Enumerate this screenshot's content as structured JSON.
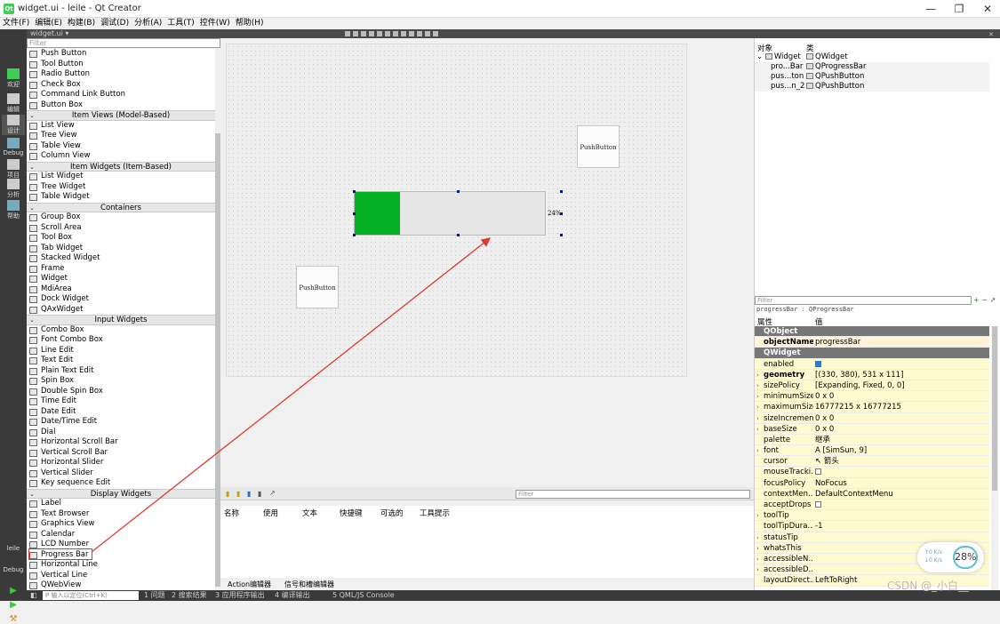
{
  "window": {
    "title": "widget.ui - leile - Qt Creator",
    "controls": [
      "—",
      "❐",
      "✕"
    ]
  },
  "menu": [
    "文件(F)",
    "编辑(E)",
    "构建(B)",
    "调试(D)",
    "分析(A)",
    "工具(T)",
    "控件(W)",
    "帮助(H)"
  ],
  "modes": [
    {
      "label": "欢迎",
      "icon": "qt-logo-icon"
    },
    {
      "label": "编辑",
      "icon": "document-icon"
    },
    {
      "label": "设计",
      "icon": "pencil-icon"
    },
    {
      "label": "Debug",
      "icon": "bug-icon"
    },
    {
      "label": "项目",
      "icon": "wrench-icon"
    },
    {
      "label": "分析",
      "icon": "monitor-icon"
    },
    {
      "label": "帮助",
      "icon": "help-icon"
    }
  ],
  "kit": {
    "project": "leile",
    "config": "Debug"
  },
  "widget_box": {
    "file_combo": "widget.ui",
    "filter_placeholder": "Filter",
    "rows": [
      {
        "type": "item",
        "label": "Push Button",
        "icon": "push-button-icon"
      },
      {
        "type": "item",
        "label": "Tool Button",
        "icon": "tool-button-icon"
      },
      {
        "type": "item",
        "label": "Radio Button",
        "icon": "radio-button-icon"
      },
      {
        "type": "item",
        "label": "Check Box",
        "icon": "check-box-icon"
      },
      {
        "type": "item",
        "label": "Command Link Button",
        "icon": "command-link-icon"
      },
      {
        "type": "item",
        "label": "Button Box",
        "icon": "button-box-icon"
      },
      {
        "type": "cat",
        "label": "Item Views (Model-Based)"
      },
      {
        "type": "item",
        "label": "List View",
        "icon": "list-view-icon"
      },
      {
        "type": "item",
        "label": "Tree View",
        "icon": "tree-view-icon"
      },
      {
        "type": "item",
        "label": "Table View",
        "icon": "table-view-icon"
      },
      {
        "type": "item",
        "label": "Column View",
        "icon": "column-view-icon"
      },
      {
        "type": "cat",
        "label": "Item Widgets (Item-Based)"
      },
      {
        "type": "item",
        "label": "List Widget",
        "icon": "list-widget-icon"
      },
      {
        "type": "item",
        "label": "Tree Widget",
        "icon": "tree-widget-icon"
      },
      {
        "type": "item",
        "label": "Table Widget",
        "icon": "table-widget-icon"
      },
      {
        "type": "cat",
        "label": "Containers"
      },
      {
        "type": "item",
        "label": "Group Box",
        "icon": "group-box-icon"
      },
      {
        "type": "item",
        "label": "Scroll Area",
        "icon": "scroll-area-icon"
      },
      {
        "type": "item",
        "label": "Tool Box",
        "icon": "tool-box-icon"
      },
      {
        "type": "item",
        "label": "Tab Widget",
        "icon": "tab-widget-icon"
      },
      {
        "type": "item",
        "label": "Stacked Widget",
        "icon": "stacked-widget-icon"
      },
      {
        "type": "item",
        "label": "Frame",
        "icon": "frame-icon"
      },
      {
        "type": "item",
        "label": "Widget",
        "icon": "widget-icon"
      },
      {
        "type": "item",
        "label": "MdiArea",
        "icon": "mdi-area-icon"
      },
      {
        "type": "item",
        "label": "Dock Widget",
        "icon": "dock-widget-icon"
      },
      {
        "type": "item",
        "label": "QAxWidget",
        "icon": "ax-widget-icon"
      },
      {
        "type": "cat",
        "label": "Input Widgets"
      },
      {
        "type": "item",
        "label": "Combo Box",
        "icon": "combo-box-icon"
      },
      {
        "type": "item",
        "label": "Font Combo Box",
        "icon": "font-combo-box-icon"
      },
      {
        "type": "item",
        "label": "Line Edit",
        "icon": "line-edit-icon"
      },
      {
        "type": "item",
        "label": "Text Edit",
        "icon": "text-edit-icon"
      },
      {
        "type": "item",
        "label": "Plain Text Edit",
        "icon": "plain-text-edit-icon"
      },
      {
        "type": "item",
        "label": "Spin Box",
        "icon": "spin-box-icon"
      },
      {
        "type": "item",
        "label": "Double Spin Box",
        "icon": "double-spin-box-icon"
      },
      {
        "type": "item",
        "label": "Time Edit",
        "icon": "time-edit-icon"
      },
      {
        "type": "item",
        "label": "Date Edit",
        "icon": "date-edit-icon"
      },
      {
        "type": "item",
        "label": "Date/Time Edit",
        "icon": "date-time-edit-icon"
      },
      {
        "type": "item",
        "label": "Dial",
        "icon": "dial-icon"
      },
      {
        "type": "item",
        "label": "Horizontal Scroll Bar",
        "icon": "hscroll-icon"
      },
      {
        "type": "item",
        "label": "Vertical Scroll Bar",
        "icon": "vscroll-icon"
      },
      {
        "type": "item",
        "label": "Horizontal Slider",
        "icon": "hslider-icon"
      },
      {
        "type": "item",
        "label": "Vertical Slider",
        "icon": "vslider-icon"
      },
      {
        "type": "item",
        "label": "Key sequence Edit",
        "icon": "key-sequence-icon"
      },
      {
        "type": "cat",
        "label": "Display Widgets"
      },
      {
        "type": "item",
        "label": "Label",
        "icon": "label-icon"
      },
      {
        "type": "item",
        "label": "Text Browser",
        "icon": "text-browser-icon"
      },
      {
        "type": "item",
        "label": "Graphics View",
        "icon": "graphics-view-icon"
      },
      {
        "type": "item",
        "label": "Calendar",
        "icon": "calendar-icon"
      },
      {
        "type": "item",
        "label": "LCD Number",
        "icon": "lcd-number-icon"
      },
      {
        "type": "item",
        "label": "Progress Bar",
        "icon": "progress-bar-icon",
        "highlighted": true
      },
      {
        "type": "item",
        "label": "Horizontal Line",
        "icon": "hline-icon"
      },
      {
        "type": "item",
        "label": "Vertical Line",
        "icon": "vline-icon"
      },
      {
        "type": "item",
        "label": "QWebView",
        "icon": "web-view-icon"
      }
    ]
  },
  "form": {
    "push_button_1": "PushButton",
    "push_button_2": "PushButton",
    "progress": {
      "value_fraction": 0.24,
      "text": "24%",
      "chunk_color": "#06b025"
    },
    "arrow_color": "#e0392b"
  },
  "action_editor": {
    "filter_placeholder": "Filter",
    "columns": [
      "名称",
      "使用",
      "文本",
      "快捷键",
      "可选的",
      "工具提示"
    ],
    "tabs": [
      "Action编辑器",
      "信号和槽编辑器"
    ]
  },
  "status_bar": {
    "locator_placeholder": "P 输入以定位(Ctrl+K)",
    "panes": [
      "1 问题",
      "2 搜索结果",
      "3 应用程序输出",
      "4 编译输出",
      "5 QML/JS Console"
    ]
  },
  "object_inspector": {
    "headers": [
      "对象",
      "类"
    ],
    "rows": [
      {
        "object": "Widget",
        "class": "QWidget",
        "level": 0
      },
      {
        "object": "pro...Bar",
        "class": "QProgressBar",
        "level": 1
      },
      {
        "object": "pus...ton",
        "class": "QPushButton",
        "level": 1
      },
      {
        "object": "pus...n_2",
        "class": "QPushButton",
        "level": 1
      }
    ]
  },
  "property_editor": {
    "filter_placeholder": "Filter",
    "title": "progressBar : QProgressBar",
    "headers": [
      "属性",
      "值"
    ],
    "rows": [
      {
        "kind": "sec",
        "name": "QObject"
      },
      {
        "kind": "obj",
        "name": "objectName",
        "value": "progressBar",
        "bold": true
      },
      {
        "kind": "sec",
        "name": "QWidget"
      },
      {
        "kind": "row",
        "name": "enabled",
        "checkbox": true,
        "checked": true
      },
      {
        "kind": "row",
        "name": "geometry",
        "value": "[(330, 380), 531 x 111]",
        "bold": true,
        "expand": true
      },
      {
        "kind": "row",
        "name": "sizePolicy",
        "value": "[Expanding, Fixed, 0, 0]",
        "expand": true
      },
      {
        "kind": "row",
        "name": "minimumSize",
        "value": "0 x 0",
        "expand": true
      },
      {
        "kind": "row",
        "name": "maximumSize",
        "value": "16777215 x 16777215",
        "expand": true
      },
      {
        "kind": "row",
        "name": "sizeIncrement",
        "value": "0 x 0",
        "expand": true
      },
      {
        "kind": "row",
        "name": "baseSize",
        "value": "0 x 0",
        "expand": true
      },
      {
        "kind": "row",
        "name": "palette",
        "value": "继承"
      },
      {
        "kind": "row",
        "name": "font",
        "value": "A  [SimSun, 9]",
        "expand": true
      },
      {
        "kind": "row",
        "name": "cursor",
        "value": "↖ 箭头"
      },
      {
        "kind": "row",
        "name": "mouseTracki...",
        "checkbox": true,
        "checked": false
      },
      {
        "kind": "row",
        "name": "focusPolicy",
        "value": "NoFocus"
      },
      {
        "kind": "row",
        "name": "contextMen...",
        "value": "DefaultContextMenu"
      },
      {
        "kind": "row",
        "name": "acceptDrops",
        "checkbox": true,
        "checked": false
      },
      {
        "kind": "row",
        "name": "toolTip",
        "value": "",
        "expand": true
      },
      {
        "kind": "row",
        "name": "toolTipDura...",
        "value": "-1"
      },
      {
        "kind": "row",
        "name": "statusTip",
        "value": "",
        "expand": true
      },
      {
        "kind": "row",
        "name": "whatsThis",
        "value": "",
        "expand": true
      },
      {
        "kind": "row",
        "name": "accessibleN...",
        "value": "",
        "expand": true
      },
      {
        "kind": "row",
        "name": "accessibleD...",
        "value": "",
        "expand": true
      },
      {
        "kind": "row",
        "name": "layoutDirect...",
        "value": "LeftToRight"
      }
    ]
  },
  "overlay": {
    "net_up": "↑0  K/s",
    "net_down": "↓0  K/s",
    "cpu": "28%",
    "watermark": "CSDN @_小白__"
  }
}
